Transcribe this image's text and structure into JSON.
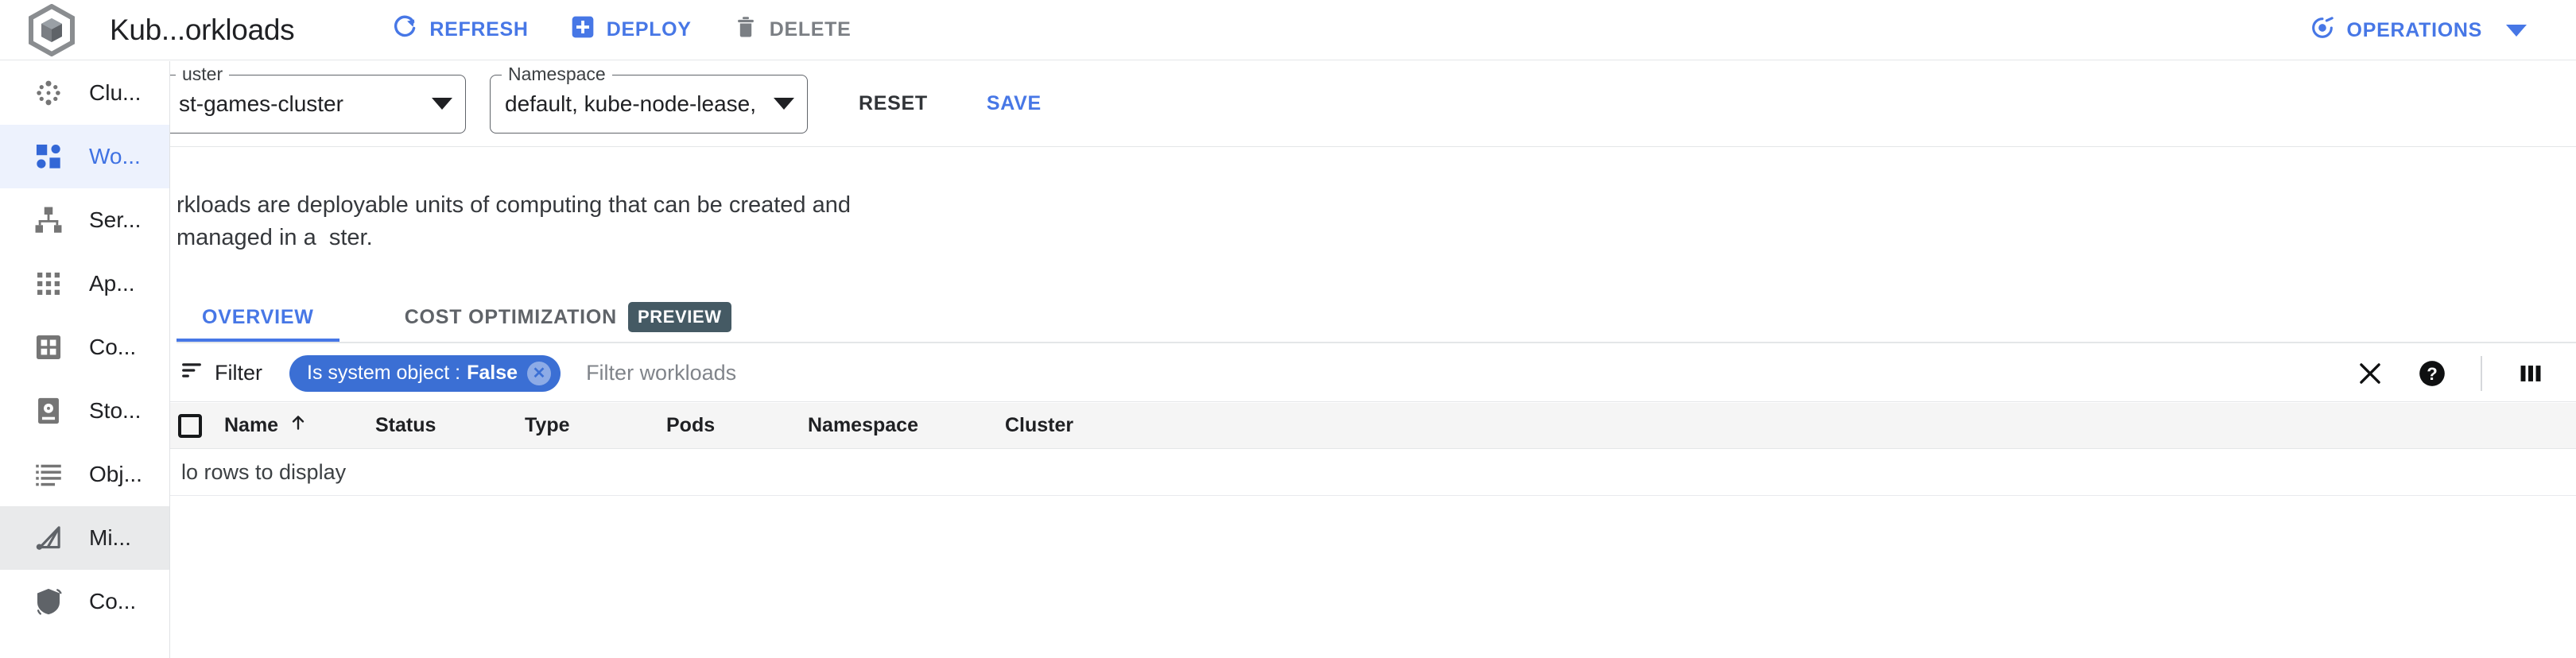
{
  "app": {
    "logo_icon": "gke-hexagon-logo-icon",
    "title": "Kub...orkloads"
  },
  "toolbar": {
    "refresh_label": "REFRESH",
    "refresh_icon": "refresh-icon",
    "deploy_label": "DEPLOY",
    "deploy_icon": "plus-square-icon",
    "delete_label": "DELETE",
    "delete_icon": "trash-icon",
    "operations_label": "OPERATIONS",
    "operations_icon": "operations-swirl-icon",
    "operations_caret_icon": "chevron-down-icon"
  },
  "selectors": {
    "cluster": {
      "label": "uster",
      "value": "st-games-cluster",
      "caret_icon": "caret-down-icon"
    },
    "namespace": {
      "label": "Namespace",
      "value": "default, kube-node-lease, …",
      "caret_icon": "caret-down-icon"
    },
    "reset_label": "RESET",
    "save_label": "SAVE"
  },
  "description": "rkloads are deployable units of computing that can be created and managed in a  ster.",
  "tabs": [
    {
      "label": "OVERVIEW",
      "active": true,
      "badge": ""
    },
    {
      "label": "COST OPTIMIZATION",
      "active": false,
      "badge": "PREVIEW"
    }
  ],
  "filter": {
    "icon": "filter-icon",
    "label": "Filter",
    "chip": {
      "key": "Is system object : ",
      "value": "False",
      "remove_icon": "close-circle-icon"
    },
    "placeholder": "Filter workloads",
    "input_value": "",
    "clear_icon": "close-icon",
    "help_icon": "help-circle-icon",
    "columns_icon": "column-settings-icon"
  },
  "table": {
    "select_all_icon": "checkbox-unchecked-icon",
    "columns": [
      {
        "label": "Name",
        "sort_icon": "sort-ascending-arrow-icon"
      },
      {
        "label": "Status",
        "sort_icon": ""
      },
      {
        "label": "Type",
        "sort_icon": ""
      },
      {
        "label": "Pods",
        "sort_icon": ""
      },
      {
        "label": "Namespace",
        "sort_icon": ""
      },
      {
        "label": "Cluster",
        "sort_icon": ""
      }
    ],
    "empty_message": "lo rows to display"
  },
  "sidebar": {
    "items": [
      {
        "label": "Clu...",
        "icon": "clusters-dots-icon",
        "state": "normal"
      },
      {
        "label": "Wo...",
        "icon": "workloads-squares-icon",
        "state": "active"
      },
      {
        "label": "Ser...",
        "icon": "services-hierarchy-icon",
        "state": "normal"
      },
      {
        "label": "Ap...",
        "icon": "applications-grid-icon",
        "state": "normal"
      },
      {
        "label": "Co...",
        "icon": "configuration-grid-icon",
        "state": "normal"
      },
      {
        "label": "Sto...",
        "icon": "storage-disk-icon",
        "state": "normal"
      },
      {
        "label": "Obj...",
        "icon": "object-browser-list-icon",
        "state": "normal"
      },
      {
        "label": "Mi...",
        "icon": "migrate-icon",
        "state": "hovered"
      },
      {
        "label": "Co...",
        "icon": "config-shield-icon",
        "state": "normal"
      }
    ]
  },
  "colors": {
    "accent_blue": "#4777e6",
    "chip_blue": "#3b6fd4",
    "active_bg": "#edf2fd",
    "hover_bg": "#e9eaeb",
    "preview_badge": "#455a64",
    "icon_gray": "#757575",
    "header_bg": "#f5f5f5"
  }
}
